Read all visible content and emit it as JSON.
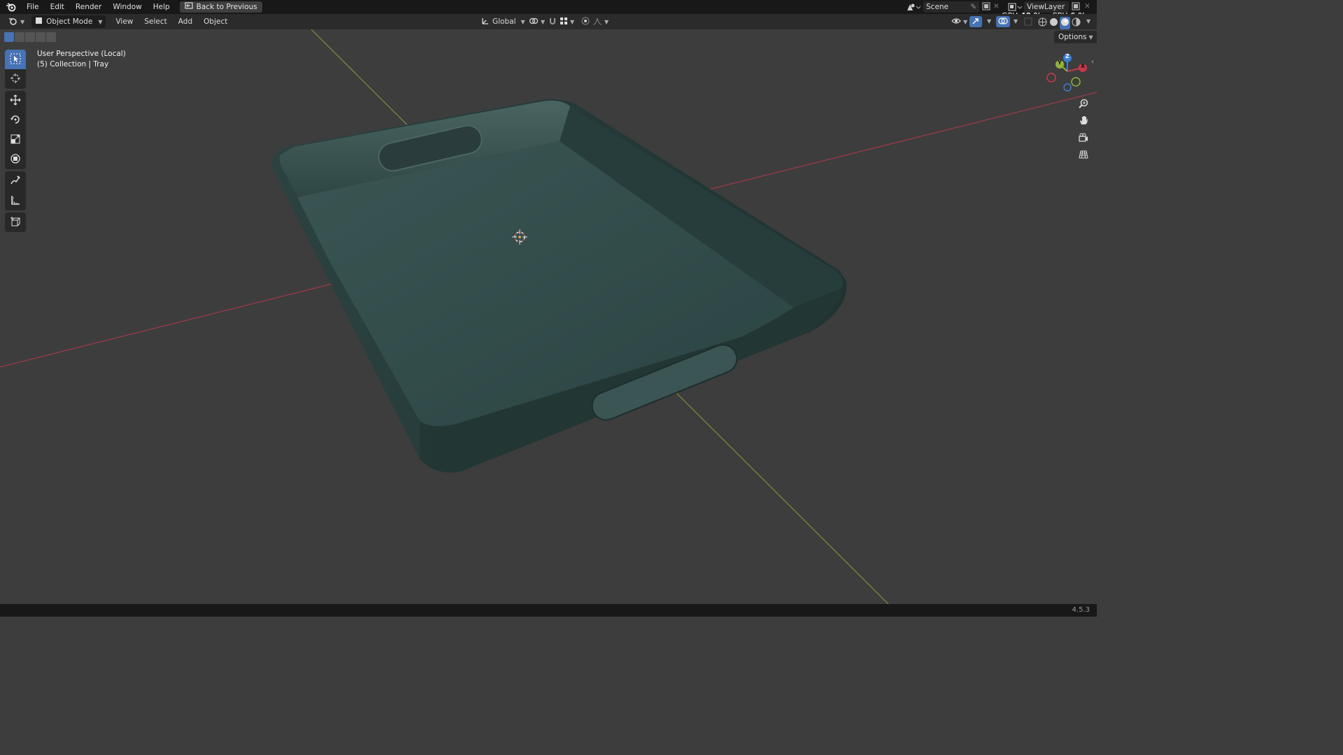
{
  "menu": {
    "items": [
      "File",
      "Edit",
      "Render",
      "Window",
      "Help"
    ],
    "back_label": "Back to Previous"
  },
  "scene": {
    "label": "Scene"
  },
  "view_layer": {
    "label": "ViewLayer"
  },
  "performance": {
    "gpu_label": "GPU",
    "gpu_value": "40 %",
    "cpu_label": "CPU",
    "cpu_value": "6 %"
  },
  "header": {
    "mode_label": "Object Mode",
    "menus": [
      "View",
      "Select",
      "Add",
      "Object"
    ],
    "transform_orientation": "Global",
    "options_label": "Options"
  },
  "viewport": {
    "perspective_label": "User Perspective (Local)",
    "collection_label": "(5) Collection | Tray"
  },
  "gizmo": {
    "z": "Z",
    "y": "Y",
    "x": "X"
  },
  "status": {
    "version": "4.5.3"
  },
  "colors": {
    "accent": "#4772b3",
    "x_axis": "#c8394b",
    "y_axis": "#8fb33a",
    "z_axis": "#3b7ed6",
    "tray": "#2f4a48"
  }
}
